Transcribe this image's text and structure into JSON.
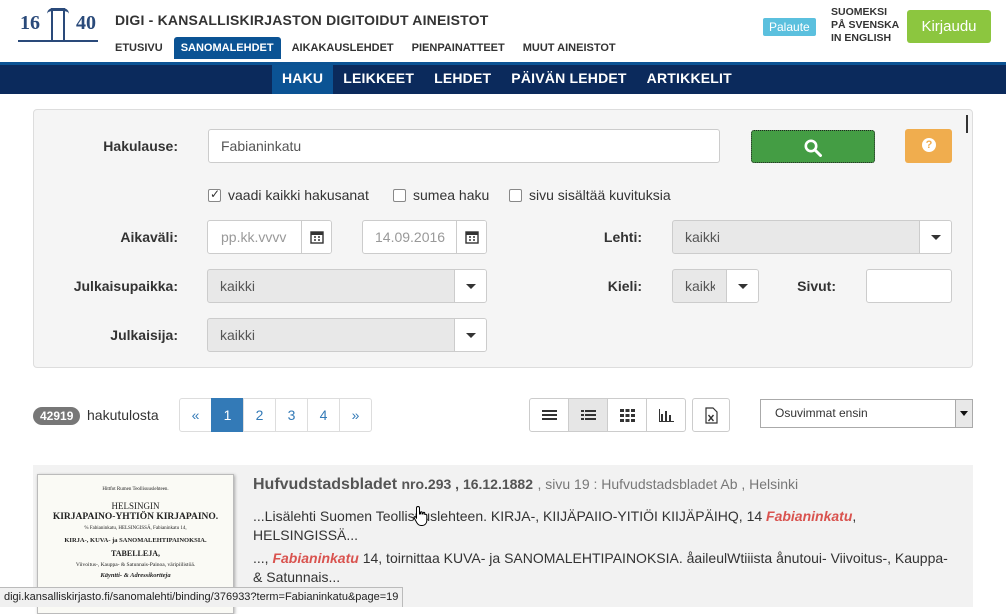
{
  "header": {
    "logo_left": "16",
    "logo_right": "40",
    "site_title": "DIGI - KANSALLISKIRJASTON DIGITOIDUT AINEISTOT",
    "main_nav": [
      "ETUSIVU",
      "SANOMALEHDET",
      "AIKAKAUSLEHDET",
      "PIENPAINATTEET",
      "MUUT AINEISTOT"
    ],
    "main_nav_active": "SANOMALEHDET",
    "feedback_label": "Palaute",
    "languages": [
      "SUOMEKSI",
      "PÅ SVENSKA",
      "IN ENGLISH"
    ],
    "login_label": "Kirjaudu"
  },
  "subnav": {
    "items": [
      "HAKU",
      "LEIKKEET",
      "LEHDET",
      "PÄIVÄN LEHDET",
      "ARTIKKELIT"
    ],
    "active": "HAKU"
  },
  "search": {
    "query_label": "Hakulause:",
    "query_value": "Fabianinkatu",
    "checkboxes": [
      {
        "label": "vaadi kaikki hakusanat",
        "checked": true
      },
      {
        "label": "sumea haku",
        "checked": false
      },
      {
        "label": "sivu sisältää kuvituksia",
        "checked": false
      }
    ],
    "date_label": "Aikaväli:",
    "date_from_placeholder": "pp.kk.vvvv",
    "date_to_value": "14.09.2016",
    "paper_label": "Lehti:",
    "paper_value": "kaikki",
    "place_label": "Julkaisupaikka:",
    "place_value": "kaikki",
    "language_label": "Kieli:",
    "language_value": "kaikki",
    "pages_label": "Sivut:",
    "pages_value": "",
    "publisher_label": "Julkaisija:",
    "publisher_value": "kaikki"
  },
  "results_bar": {
    "count": "42919",
    "count_label": "hakutulosta",
    "pagination": [
      "«",
      "1",
      "2",
      "3",
      "4",
      "»"
    ],
    "current_page": "1",
    "sort_value": "Osuvimmat ensin"
  },
  "result": {
    "paper": "Hufvudstadsbladet",
    "issue": "nro.293 , 16.12.1882",
    "page_info": ", sivu 19 : Hufvudstadsbladet Ab , Helsinki",
    "snippet1_pre": "...Lisälehti Suomen Teollisuuslehteen. KIRJA-, KIIJÄPAIIO-YITIÖI KIIJÄPÄIHQ, 14 ",
    "snippet1_hl": "Fabianinkatu",
    "snippet1_post": ", HELSINGISSÄ...",
    "snippet2_pre": "..., ",
    "snippet2_hl": "Fabianinkatu",
    "snippet2_post": " 14, toirnittaa KUVA- ja SANOMALEHTIPAINOKSIA. åaileulWtiiista ånutoui- Viivoitus-, Kauppa- & Satunnais...",
    "thumb_lines": [
      "Hittfot Rumen Teollisuuslehteen.",
      "HELSINGIN",
      "KIRJAPAINO-YHTIÖN KIRJAPAINO.",
      "% Fabianinkatu, HELSINGISSÄ, Fabianinkatu 14,",
      "KIRJA-, KUVA- ja SANOMALEHTIPAINOKSIA.",
      "TABELLEJA,",
      "Viivoitus-, Kauppa- & Satunnais-Painoa, väripiilistöä.",
      "Käyntti- & Adressikortteja"
    ]
  },
  "statusbar": {
    "url": "digi.kansalliskirjasto.fi/sanomalehti/binding/376933?term=Fabianinkatu&page=19"
  }
}
